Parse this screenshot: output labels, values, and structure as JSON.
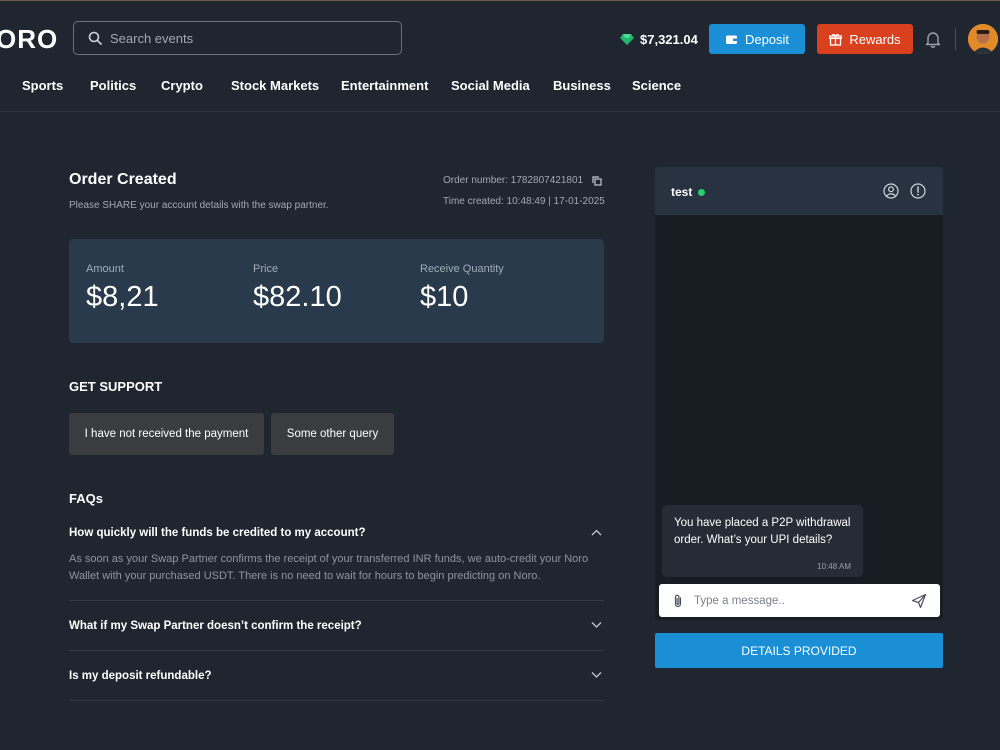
{
  "header": {
    "logo": "ORO",
    "search_placeholder": "Search events",
    "balance": "$7,321.04",
    "deposit_label": "Deposit",
    "rewards_label": "Rewards"
  },
  "nav": [
    {
      "label": "Sports"
    },
    {
      "label": "Politics"
    },
    {
      "label": "Crypto"
    },
    {
      "label": "Stock Markets"
    },
    {
      "label": "Entertainment"
    },
    {
      "label": "Social Media"
    },
    {
      "label": "Business"
    },
    {
      "label": "Science"
    }
  ],
  "order": {
    "title": "Order Created",
    "subtitle": "Please SHARE your account details with the swap partner.",
    "number_text": "Order number: 1782807421801",
    "time_text": "Time created: 10:48:49 | 17-01-2025"
  },
  "stats": [
    {
      "label": "Amount",
      "value": "$8,21"
    },
    {
      "label": "Price",
      "value": "$82.10"
    },
    {
      "label": "Receive Quantity",
      "value": "$10"
    }
  ],
  "support": {
    "title": "GET SUPPORT",
    "buttons": [
      {
        "label": "I have not received the payment"
      },
      {
        "label": "Some other query"
      }
    ]
  },
  "faqs": {
    "title": "FAQs",
    "items": [
      {
        "question": "How quickly will the funds be credited to my account?",
        "answer": "As soon as your Swap Partner confirms the receipt of your transferred INR funds, we auto-credit your Noro Wallet with your purchased USDT. There is no need to wait for hours to begin predicting on Noro.",
        "expanded": true
      },
      {
        "question": "What if my Swap Partner doesn’t confirm the receipt?",
        "expanded": false
      },
      {
        "question": "Is my deposit refundable?",
        "expanded": false
      }
    ]
  },
  "chat": {
    "name": "test",
    "status_color": "#2ecc71",
    "message": "You have placed a P2P withdrawal order. What’s your UPI details?",
    "message_time": "10:48 AM",
    "input_placeholder": "Type a message..",
    "action_label": "DETAILS PROVIDED"
  },
  "colors": {
    "background": "#1f2630",
    "accent_blue": "#1a8fd6",
    "rewards_red": "#d9411e",
    "stats_panel": "#283a4b"
  }
}
